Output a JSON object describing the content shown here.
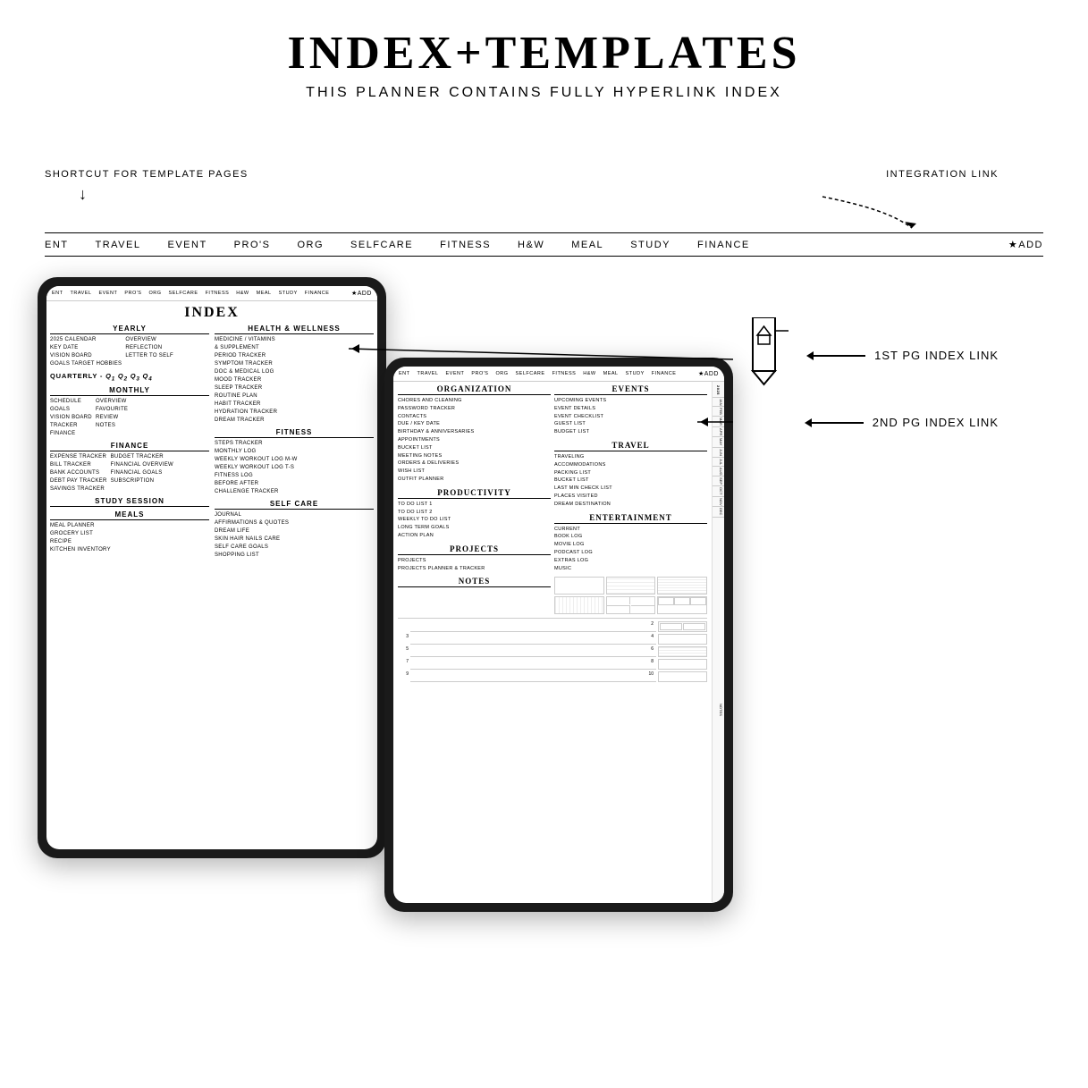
{
  "header": {
    "title": "INDEX+TEMPLATES",
    "subtitle": "THIS PLANNER CONTAINS FULLY HYPERLINK INDEX"
  },
  "labels": {
    "shortcut": "SHORTCUT FOR TEMPLATE PAGES",
    "integration": "INTEGRATION LINK",
    "index_link_1": "1ST PG INDEX LINK",
    "index_link_2": "2ND PG INDEX LINK",
    "arrow_down": "↓"
  },
  "nav": {
    "items": [
      "ENT",
      "TRAVEL",
      "EVENT",
      "PRO'S",
      "ORG",
      "SELFCARE",
      "FITNESS",
      "H&W",
      "MEAL",
      "STUDY",
      "FINANCE",
      "★ADD"
    ]
  },
  "tablet_left": {
    "nav": [
      "ENT",
      "TRAVEL",
      "EVENT",
      "PRO'S",
      "ORG",
      "SELFCARE",
      "FITNESS",
      "H&W",
      "MEAL",
      "STUDY",
      "FINANCE",
      "★ADD"
    ],
    "title": "INDEX",
    "sections": {
      "yearly": {
        "title": "YEARLY",
        "items": [
          "2025 CALENDAR",
          "KEY DATE",
          "VISION BOARD",
          "GOALS TARGET HOBBIES"
        ],
        "sub_items": [
          "OVERVIEW",
          "REFLECTION",
          "LETTER TO SELF"
        ]
      },
      "quarterly": {
        "title": "QUARTERLY -",
        "quarters": [
          "Q1",
          "Q2",
          "Q3",
          "Q4"
        ]
      },
      "monthly": {
        "title": "MONTHLY",
        "items": [
          "SCHEDULE",
          "GOALS",
          "VISION BOARD",
          "TRACKER",
          "FINANCE"
        ],
        "sub_items": [
          "OVERVIEW",
          "FAVOURITE",
          "REVIEW",
          "NOTES"
        ]
      },
      "finance": {
        "title": "FINANCE",
        "items": [
          "EXPENSE TRACKER",
          "BILL TRACKER",
          "BANK ACCOUNTS",
          "DEBT PAY TRACKER",
          "SAVINGS TRACKER"
        ],
        "sub_items": [
          "BUDGET TRACKER",
          "FINANCIAL OVERVIEW",
          "FINANCIAL GOALS",
          "SUBSCRIPTION"
        ]
      },
      "study": {
        "title": "STUDY SESSION"
      },
      "meals": {
        "title": "MEALS",
        "items": [
          "MEAL PLANNER",
          "GROCERY LIST",
          "RECIPE",
          "KITCHEN INVENTORY"
        ]
      },
      "health": {
        "title": "HEALTH & WELLNESS",
        "items": [
          "MEDICINE / VITAMINS & SUPPLEMENT",
          "PERIOD TRACKER",
          "SYMPTOM TRACKER",
          "DOC & MEDICAL LOG",
          "MOOD TRACKER",
          "SLEEP TRACKER",
          "ROUTINE PLAN",
          "HABIT TRACKER",
          "HYDRATION TRACKER",
          "DREAM TRACKER"
        ]
      },
      "fitness": {
        "title": "FITNESS",
        "items": [
          "STEPS TRACKER",
          "MONTHLY LOG",
          "WEEKLY WORKOUT LOG M-W",
          "WEEKLY WORKOUT LOG T-S",
          "FITNESS LOG",
          "BEFORE AFTER",
          "CHALLENGE TRACKER"
        ]
      },
      "selfcare": {
        "title": "SELF CARE",
        "items": [
          "JOURNAL",
          "AFFIRMATIONS & QUOTES",
          "DREAM LIFE",
          "SKIN HAIR NAILS CARE",
          "SELF CARE GOALS",
          "SHOPPING LIST"
        ]
      }
    }
  },
  "tablet_right": {
    "nav": [
      "ENT",
      "TRAVEL",
      "EVENT",
      "PRO'S",
      "ORG",
      "SELFCARE",
      "FITNESS",
      "H&W",
      "MEAL",
      "STUDY",
      "FINANCE",
      "★ADD"
    ],
    "sections": {
      "organization": {
        "title": "ORGANIZATION",
        "items": [
          "CHORES AND CLEANING",
          "PASSWORD TRACKER",
          "CONTACTS",
          "DUE / KEY DATE",
          "BIRTHDAY & ANNIVERSARIES",
          "APPOINTMENTS",
          "BUCKET LIST",
          "MEETING NOTES",
          "ORDERS & DELIVERIES",
          "WISH LIST",
          "OUTFIT PLANNER"
        ]
      },
      "events": {
        "title": "EVENTS",
        "items": [
          "UPCOMING EVENTS",
          "EVENT DETAILS",
          "EVENT CHECKLIST",
          "GUEST LIST",
          "BUDGET LIST"
        ]
      },
      "productivity": {
        "title": "PRODUCTIVITY",
        "items": [
          "TO DO LIST 1",
          "TO DO LIST 2",
          "WEEKLY TO DO LIST",
          "LONG TERM GOALS",
          "ACTION PLAN"
        ]
      },
      "travel": {
        "title": "TRAVEL",
        "items": [
          "TRAVELING",
          "ACCOMMODATIONS",
          "PACKING LIST",
          "BUCKET LIST",
          "LAST MIN CHECK LIST",
          "PLACES VISITED",
          "DREAM DESTINATION"
        ]
      },
      "projects": {
        "title": "PROJECTS",
        "items": [
          "PROJECTS",
          "PROJECTS PLANNER & TRACKER"
        ]
      },
      "entertainment": {
        "title": "ENTERTAINMENT",
        "items": [
          "CURRENT",
          "BOOK LOG",
          "MOVIE LOG",
          "PODCAST LOG",
          "EXTRAS LOG",
          "MUSIC"
        ]
      },
      "notes": {
        "title": "NOTES",
        "rows": [
          [
            "",
            "2"
          ],
          [
            "3",
            "4"
          ],
          [
            "5",
            "6"
          ],
          [
            "7",
            "8"
          ],
          [
            "9",
            "10"
          ]
        ]
      }
    },
    "sidebar": {
      "items": [
        "2025",
        "JAN",
        "FEB",
        "MAR",
        "APR",
        "MAY",
        "JUN",
        "JUL",
        "AUG",
        "SEP",
        "OCT",
        "NOV",
        "DEC",
        "NOTES"
      ]
    }
  }
}
